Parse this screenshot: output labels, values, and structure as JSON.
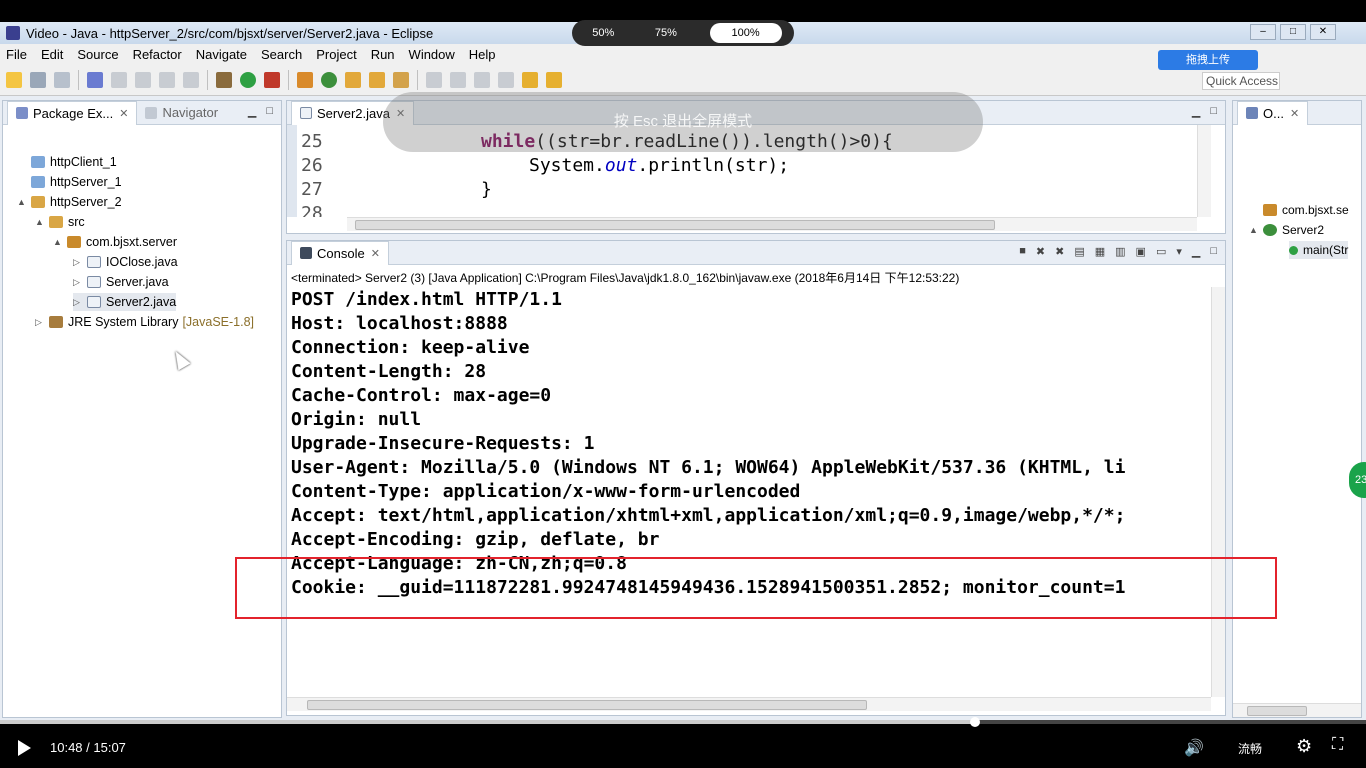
{
  "window": {
    "title": "Video - Java - httpServer_2/src/com/bjsxt/server/Server2.java - Eclipse"
  },
  "zoom": {
    "options": [
      "50%",
      "75%",
      "100%"
    ],
    "selected": "100%"
  },
  "watermark": {
    "upload_label": "拖拽上传"
  },
  "menu": [
    "File",
    "Edit",
    "Source",
    "Refactor",
    "Navigate",
    "Search",
    "Project",
    "Run",
    "Window",
    "Help"
  ],
  "quick_access": "Quick Access",
  "left_panel": {
    "tabs": [
      "Package Ex...",
      "Navigator"
    ],
    "tree": [
      {
        "label": "httpClient_1",
        "level": 0,
        "twisty": ""
      },
      {
        "label": "httpServer_1",
        "level": 0,
        "twisty": ""
      },
      {
        "label": "httpServer_2",
        "level": 0,
        "twisty": "▲"
      },
      {
        "label": "src",
        "level": 1,
        "twisty": "▲"
      },
      {
        "label": "com.bjsxt.server",
        "level": 2,
        "twisty": "▲"
      },
      {
        "label": "IOClose.java",
        "level": 3,
        "twisty": "▷"
      },
      {
        "label": "Server.java",
        "level": 3,
        "twisty": "▷"
      },
      {
        "label": "Server2.java",
        "level": 3,
        "twisty": "▷"
      },
      {
        "label": "JRE System Library",
        "level": 1,
        "twisty": "▷",
        "suffix": "[JavaSE-1.8]"
      }
    ]
  },
  "editor": {
    "tab": "Server2.java",
    "esc_hint": "按 Esc 退出全屏模式",
    "lines": [
      {
        "num": "25",
        "code": "while((str=br.readLine()).length()>0){"
      },
      {
        "num": "26",
        "code": "System.out.println(str);"
      },
      {
        "num": "27",
        "code": "}"
      },
      {
        "num": "28",
        "code": ""
      }
    ]
  },
  "console": {
    "tab": "Console",
    "status": "<terminated> Server2 (3) [Java Application] C:\\Program Files\\Java\\jdk1.8.0_162\\bin\\javaw.exe (2018年6月14日 下午12:53:22)",
    "lines": [
      "POST /index.html HTTP/1.1",
      "Host: localhost:8888",
      "Connection: keep-alive",
      "Content-Length: 28",
      "Cache-Control: max-age=0",
      "Origin: null",
      "Upgrade-Insecure-Requests: 1",
      "User-Agent: Mozilla/5.0 (Windows NT 6.1; WOW64) AppleWebKit/537.36 (KHTML, li",
      "Content-Type: application/x-www-form-urlencoded",
      "Accept: text/html,application/xhtml+xml,application/xml;q=0.9,image/webp,*/*;",
      "Accept-Encoding: gzip, deflate, br",
      "Accept-Language: zh-CN,zh;q=0.8",
      "Cookie: __guid=111872281.9924748145949436.1528941500351.2852; monitor_count=1"
    ]
  },
  "outline": {
    "tab": "O...",
    "items": [
      "com.bjsxt.se",
      "Server2",
      "main(Str"
    ]
  },
  "player": {
    "time": "10:48 / 15:07",
    "quality": "流畅",
    "progress": 0.714
  },
  "side_badge": "23",
  "colors": {
    "highlight": "#e3232c",
    "keyword": "#7f0055",
    "field": "#0000c0"
  }
}
